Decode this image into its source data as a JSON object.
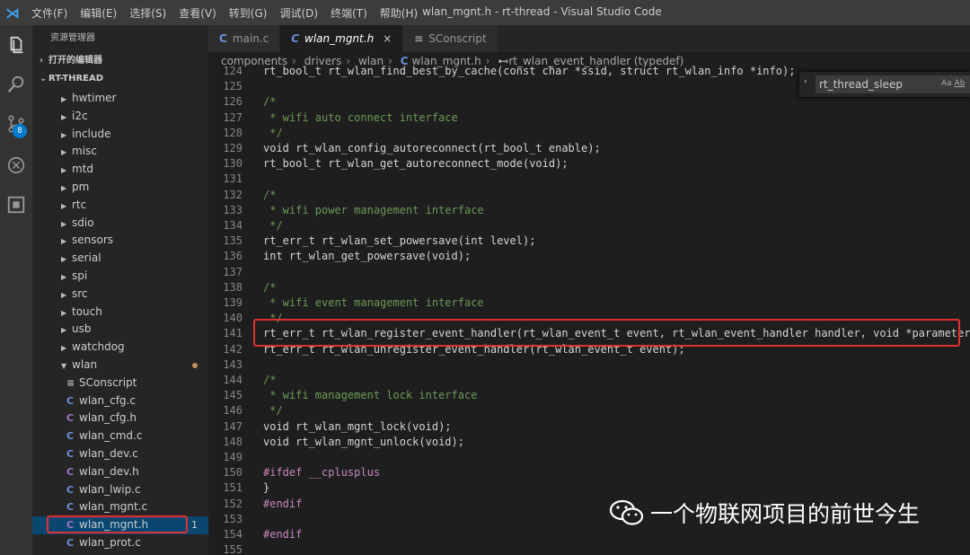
{
  "window": {
    "title": "wlan_mgnt.h - rt-thread - Visual Studio Code",
    "menu": [
      "文件(F)",
      "编辑(E)",
      "选择(S)",
      "查看(V)",
      "转到(G)",
      "调试(D)",
      "终端(T)",
      "帮助(H)"
    ]
  },
  "activity": {
    "scm_badge": "8"
  },
  "sidebar": {
    "title": "资源管理器",
    "open_editors": "打开的编辑器",
    "root": "RT-THREAD",
    "folders_collapsed": [
      "hwtimer",
      "i2c",
      "include",
      "misc",
      "mtd",
      "pm",
      "rtc",
      "sdio",
      "sensors",
      "serial",
      "spi",
      "src",
      "touch",
      "usb",
      "watchdog"
    ],
    "open_folder": "wlan",
    "files": [
      "SConscript",
      "wlan_cfg.c",
      "wlan_cfg.h",
      "wlan_cmd.c",
      "wlan_dev.c",
      "wlan_dev.h",
      "wlan_lwip.c",
      "wlan_mgnt.c",
      "wlan_mgnt.h",
      "wlan_prot.c"
    ],
    "selected_file_problems": "1"
  },
  "tabs": [
    {
      "label": "main.c",
      "icon": "C"
    },
    {
      "label": "wlan_mgnt.h",
      "icon": "C",
      "close": "×"
    },
    {
      "label": "SConscript",
      "icon": "≡"
    }
  ],
  "breadcrumb": {
    "items": [
      "components",
      "drivers",
      "wlan",
      "wlan_mgnt.h",
      "rt_wlan_event_handler (typedef)"
    ]
  },
  "find": {
    "value": "rt_thread_sleep",
    "match_case": "Aa",
    "whole_word": "Ab"
  },
  "code_lines": [
    {
      "n": "124",
      "t": "rt_bool_t rt_wlan_find_best_by_cache(const char *ssid, struct rt_wlan_info *info);",
      "k": "tx"
    },
    {
      "n": "125",
      "t": "",
      "k": "tx"
    },
    {
      "n": "126",
      "t": "/*",
      "k": "comment"
    },
    {
      "n": "127",
      "t": " * wifi auto connect interface",
      "k": "comment"
    },
    {
      "n": "128",
      "t": " */",
      "k": "comment"
    },
    {
      "n": "129",
      "t": "void rt_wlan_config_autoreconnect(rt_bool_t enable);",
      "k": "tx"
    },
    {
      "n": "130",
      "t": "rt_bool_t rt_wlan_get_autoreconnect_mode(void);",
      "k": "tx"
    },
    {
      "n": "131",
      "t": "",
      "k": "tx"
    },
    {
      "n": "132",
      "t": "/*",
      "k": "comment"
    },
    {
      "n": "133",
      "t": " * wifi power management interface",
      "k": "comment"
    },
    {
      "n": "134",
      "t": " */",
      "k": "comment"
    },
    {
      "n": "135",
      "t": "rt_err_t rt_wlan_set_powersave(int level);",
      "k": "tx"
    },
    {
      "n": "136",
      "t": "int rt_wlan_get_powersave(void);",
      "k": "tx"
    },
    {
      "n": "137",
      "t": "",
      "k": "tx"
    },
    {
      "n": "138",
      "t": "/*",
      "k": "comment"
    },
    {
      "n": "139",
      "t": " * wifi event management interface",
      "k": "comment"
    },
    {
      "n": "140",
      "t": " */",
      "k": "comment"
    },
    {
      "n": "141",
      "t": "rt_err_t rt_wlan_register_event_handler(rt_wlan_event_t event, rt_wlan_event_handler handler, void *parameter);",
      "k": "tx"
    },
    {
      "n": "142",
      "t": "rt_err_t rt_wlan_unregister_event_handler(rt_wlan_event_t event);",
      "k": "tx"
    },
    {
      "n": "143",
      "t": "",
      "k": "tx"
    },
    {
      "n": "144",
      "t": "/*",
      "k": "comment"
    },
    {
      "n": "145",
      "t": " * wifi management lock interface",
      "k": "comment"
    },
    {
      "n": "146",
      "t": " */",
      "k": "comment"
    },
    {
      "n": "147",
      "t": "void rt_wlan_mgnt_lock(void);",
      "k": "tx"
    },
    {
      "n": "148",
      "t": "void rt_wlan_mgnt_unlock(void);",
      "k": "tx"
    },
    {
      "n": "149",
      "t": "",
      "k": "tx"
    },
    {
      "n": "150",
      "t": "#ifdef __cplusplus",
      "k": "pp"
    },
    {
      "n": "151",
      "t": "}",
      "k": "tx"
    },
    {
      "n": "152",
      "t": "#endif",
      "k": "pp"
    },
    {
      "n": "153",
      "t": "",
      "k": "tx"
    },
    {
      "n": "154",
      "t": "#endif",
      "k": "pp"
    },
    {
      "n": "155",
      "t": "",
      "k": "tx"
    }
  ],
  "watermark": "一个物联网项目的前世今生",
  "colors": {
    "highlight_box": "#e03030",
    "accent": "#007acc"
  }
}
